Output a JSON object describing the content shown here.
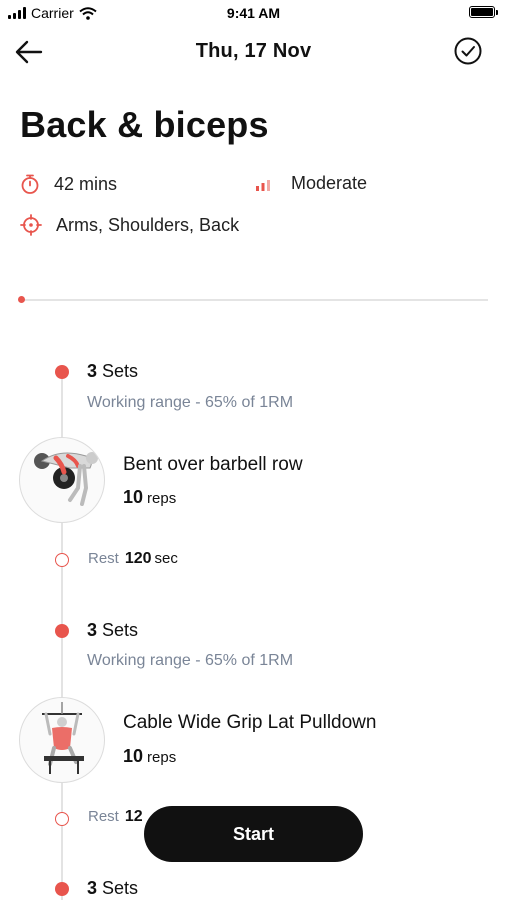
{
  "status_bar": {
    "carrier": "Carrier",
    "time": "9:41 AM"
  },
  "nav": {
    "title": "Thu, 17 Nov",
    "back_icon": "arrow-left-icon",
    "done_icon": "check-circle-icon"
  },
  "workout": {
    "title": "Back & biceps",
    "duration": "42 mins",
    "intensity": "Moderate",
    "target": "Arms, Shoulders, Back",
    "progress": 0.0
  },
  "exercises": [
    {
      "sets_count": "3",
      "sets_label": "Sets",
      "working_range": "Working range - 65% of 1RM",
      "name": "Bent over barbell row",
      "reps_count": "10",
      "reps_label": "reps",
      "rest_label": "Rest",
      "rest_value": "120",
      "rest_unit": "sec"
    },
    {
      "sets_count": "3",
      "sets_label": "Sets",
      "working_range": "Working range - 65% of 1RM",
      "name": "Cable Wide Grip Lat Pulldown",
      "reps_count": "10",
      "reps_label": "reps",
      "rest_label": "Rest",
      "rest_value": "12"
    },
    {
      "sets_count": "3",
      "sets_label": "Sets"
    }
  ],
  "start_button": {
    "label": "Start"
  },
  "colors": {
    "accent": "#e8554d",
    "muted": "#7a8597",
    "button": "#111111"
  }
}
